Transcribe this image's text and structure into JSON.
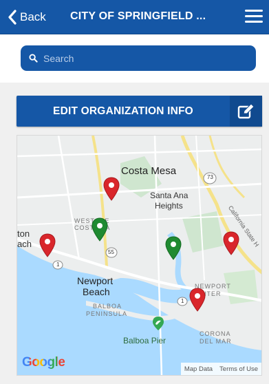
{
  "header": {
    "back_label": "Back",
    "title": "CITY OF SPRINGFIELD ...",
    "menu_icon": "hamburger-menu-icon",
    "color": "#1557a6"
  },
  "search": {
    "placeholder": "Search",
    "icon": "search-icon"
  },
  "edit_button": {
    "label": "EDIT ORGANIZATION INFO",
    "icon": "edit-icon"
  },
  "map": {
    "labels": {
      "costa_mesa": "Costa Mesa",
      "santa_ana": "Santa Ana",
      "heights": "Heights",
      "westside": "WEST  IDE",
      "costa_sa": "COSTA  SA",
      "ton": "ton",
      "ach": "ach",
      "newport": "Newport",
      "beach": "Beach",
      "balboa": "BALBOA",
      "peninsula": "PENINSULA",
      "balboa_pier": "Balboa Pier",
      "newport_center_1": "NEWPORT",
      "newport_center_2": "NTER",
      "corona": "CORONA",
      "del_mar": "DEL MAR",
      "highway_73": "73",
      "highway_55": "55",
      "highway_1a": "1",
      "highway_1b": "1",
      "freeway": "California State H"
    },
    "pins": [
      {
        "color": "red"
      },
      {
        "color": "green"
      },
      {
        "color": "red"
      },
      {
        "color": "green"
      },
      {
        "color": "red"
      },
      {
        "color": "red"
      }
    ],
    "google_logo": "Google",
    "map_data": "Map Data",
    "terms": "Terms of Use"
  }
}
